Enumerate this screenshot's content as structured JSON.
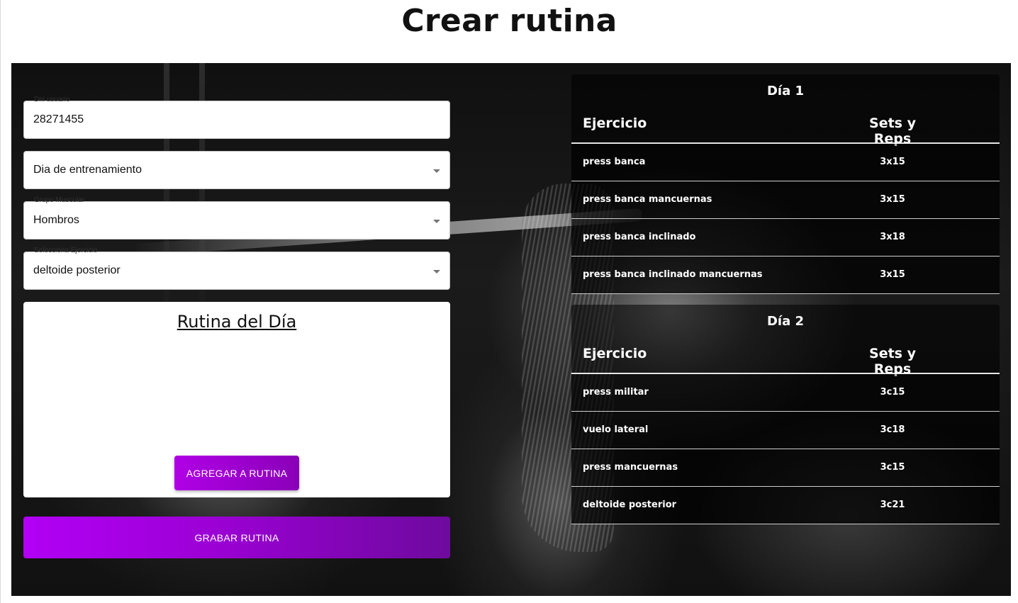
{
  "page_title": "Crear rutina",
  "form": {
    "dni": {
      "label": "Dni usuario",
      "value": "28271455"
    },
    "training_day": {
      "value": "Dia de entrenamiento"
    },
    "muscle_group": {
      "label": "Grupo Muscular",
      "value": "Hombros"
    },
    "exercise": {
      "label": "Selecciona Ejercicio",
      "value": "deltoide posterior"
    }
  },
  "routine_card": {
    "title": "Rutina del Día",
    "add_button": "AGREGAR A RUTINA"
  },
  "save_button": "GRABAR RUTINA",
  "colors": {
    "accent_purple": "#b000e6",
    "accent_purple_dark": "#7a0aa8"
  },
  "days": [
    {
      "title": "Día 1",
      "col_exercise": "Ejercicio",
      "col_sets": "Sets y Reps",
      "rows": [
        {
          "exercise": "press banca",
          "sets": "3x15"
        },
        {
          "exercise": "press banca mancuernas",
          "sets": "3x15"
        },
        {
          "exercise": "press banca inclinado",
          "sets": "3x18"
        },
        {
          "exercise": "press banca inclinado mancuernas",
          "sets": "3x15"
        }
      ]
    },
    {
      "title": "Día 2",
      "col_exercise": "Ejercicio",
      "col_sets": "Sets y Reps",
      "rows": [
        {
          "exercise": "press militar",
          "sets": "3c15"
        },
        {
          "exercise": "vuelo lateral",
          "sets": "3c18"
        },
        {
          "exercise": "press mancuernas",
          "sets": "3c15"
        },
        {
          "exercise": "deltoide posterior",
          "sets": "3c21"
        }
      ]
    }
  ]
}
